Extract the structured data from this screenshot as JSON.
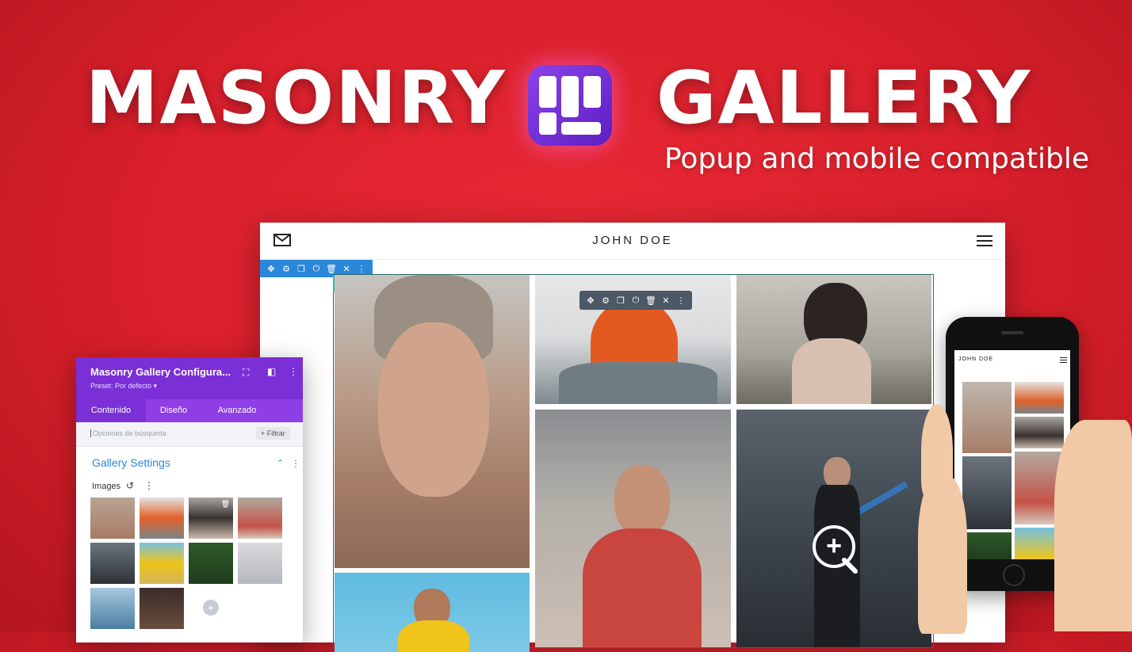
{
  "hero": {
    "title_left": "MASONRY",
    "title_right": "GALLERY",
    "subtitle": "Popup and mobile compatible"
  },
  "browser": {
    "site_title": "JOHN DOE",
    "row_toolbar_icons": [
      "move-icon",
      "gear-icon",
      "duplicate-icon",
      "power-icon",
      "trash-icon",
      "close-icon",
      "more-icon"
    ],
    "column_toolbar_icons": [
      "move-icon",
      "gear-icon",
      "duplicate-icon",
      "columns-icon",
      "power-icon",
      "trash-icon",
      "close-icon",
      "more-icon"
    ],
    "module_toolbar_icons": [
      "move-icon",
      "gear-icon",
      "duplicate-icon",
      "power-icon",
      "trash-icon",
      "close-icon",
      "more-icon"
    ]
  },
  "panel": {
    "title": "Masonry Gallery Configura...",
    "preset": "Preset: Por defecto ▾",
    "tabs": [
      {
        "label": "Contenido",
        "active": true
      },
      {
        "label": "Diseño",
        "active": false
      },
      {
        "label": "Avanzado",
        "active": false
      }
    ],
    "search_placeholder": "Opciones de búsqueda",
    "filter_label": "+ Filtrar",
    "section_title": "Gallery Settings",
    "images_label": "Images"
  },
  "phone": {
    "site_title": "JOHN DOE"
  },
  "colors": {
    "background": "#d81f2b",
    "panel_purple": "#7b2fd6",
    "row_toolbar": "#2b87da",
    "column_toolbar": "#29c4a9",
    "module_toolbar": "#4c5866",
    "accent_blue": "#2b87da"
  }
}
